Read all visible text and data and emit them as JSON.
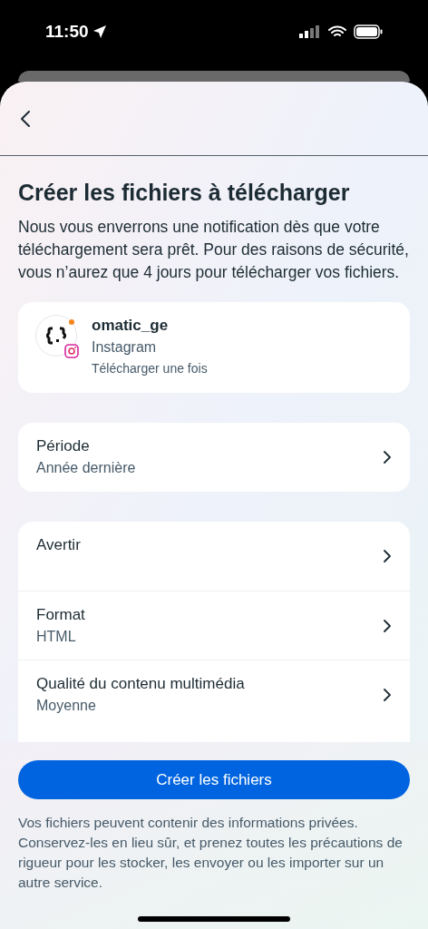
{
  "status_bar": {
    "time": "11:50"
  },
  "title": "Créer les fichiers à télécharger",
  "description": "Nous vous enverrons une notification dès que votre téléchargement sera prêt. Pour des raisons de sécurité, vous n’aurez que 4 jours pour télécharger vos fichiers.",
  "account": {
    "username": "omatic_ge",
    "platform": "Instagram",
    "note": "Télécharger une fois"
  },
  "period": {
    "label": "Période",
    "value": "Année dernière"
  },
  "settings": [
    {
      "label": "Avertir"
    },
    {
      "label": "Format",
      "value": "HTML"
    },
    {
      "label": "Qualité du contenu multimédia",
      "value": "Moyenne"
    }
  ],
  "create_button": "Créer les fichiers",
  "footer_note": "Vos fichiers peuvent contenir des informations privées. Conservez-les en lieu sûr, et prenez toutes les précautions de rigueur pour les stocker, les envoyer ou les importer sur un autre service."
}
